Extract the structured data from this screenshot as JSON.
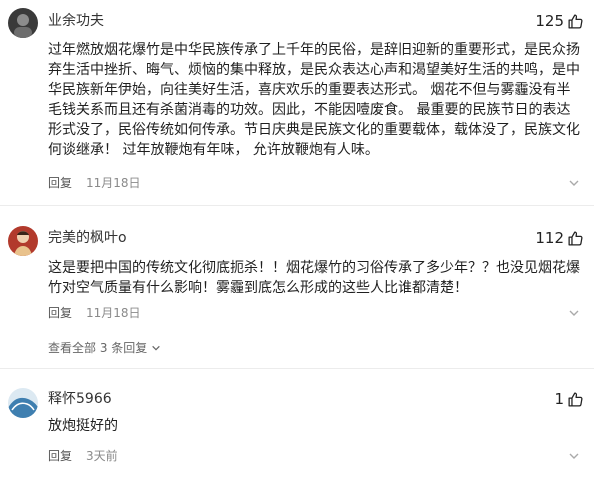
{
  "comments": [
    {
      "username": "业余功夫",
      "likes": "125",
      "text": "过年燃放烟花爆竹是中华民族传承了上千年的民俗，是辞旧迎新的重要形式，是民众扬弃生活中挫折、晦气、烦恼的集中释放，是民众表达心声和渴望美好生活的共鸣，是中华民族新年伊始，向往美好生活，喜庆欢乐的重要表达形式。 烟花不但与雾霾没有半毛钱关系而且还有杀菌消毒的功效。因此，不能因噎废食。 最重要的民族节日的表达形式没了，民俗传统如何传承。节日庆典是民族文化的重要载体，载体没了，民族文化何谈继承！ 过年放鞭炮有年味， 允许放鞭炮有人味。",
      "reply_label": "回复",
      "date": "11月18日",
      "avatar": "dark-portrait"
    },
    {
      "username": "完美的枫叶o",
      "likes": "112",
      "text": "这是要把中国的传统文化彻底扼杀！！烟花爆竹的习俗传承了多少年？？也没见烟花爆竹对空气质量有什么影响！雾霾到底怎么形成的这些人比谁都清楚！",
      "reply_label": "回复",
      "date": "11月18日",
      "avatar": "red-portrait",
      "replies_toggle": "查看全部 3 条回复"
    },
    {
      "username": "释怀5966",
      "likes": "1",
      "text": "放炮挺好的",
      "reply_label": "回复",
      "date": "3天前",
      "avatar": "wave-portrait"
    }
  ],
  "icons": {
    "like": "thumbs-up-icon",
    "more": "chevron-down-icon",
    "replies": "chevron-down-icon"
  },
  "colors": {
    "text": "#1f1f1f",
    "meta": "#8a8a8a",
    "divider": "#ececec"
  }
}
